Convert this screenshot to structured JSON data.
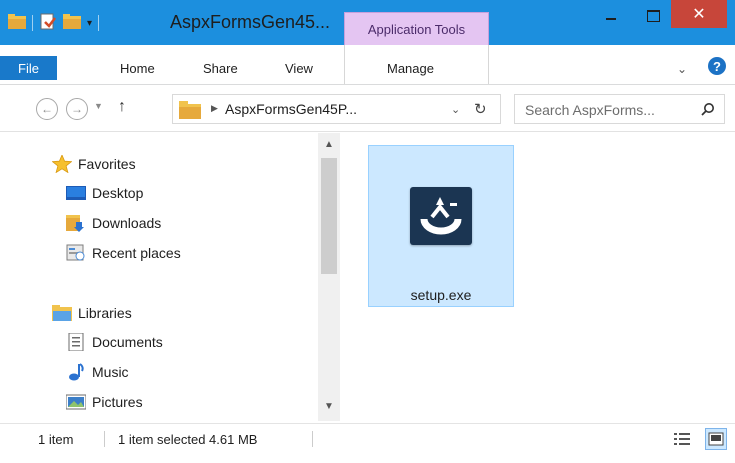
{
  "window": {
    "title": "AspxFormsGen45...",
    "context_tab": "Application Tools",
    "close_glyph": "✕"
  },
  "ribbon": {
    "tabs": [
      "File",
      "Home",
      "Share",
      "View",
      "Manage"
    ],
    "help_glyph": "?"
  },
  "address": {
    "path": "AspxFormsGen45P...",
    "search_placeholder": "Search AspxForms..."
  },
  "nav": {
    "favorites": {
      "label": "Favorites",
      "items": [
        "Desktop",
        "Downloads",
        "Recent places"
      ]
    },
    "libraries": {
      "label": "Libraries",
      "items": [
        "Documents",
        "Music",
        "Pictures"
      ]
    }
  },
  "content": {
    "files": [
      {
        "name": "setup.exe",
        "selected": true,
        "icon": "installer-icon"
      }
    ]
  },
  "status": {
    "item_count": "1 item",
    "selection": "1 item selected  4.61 MB"
  },
  "colors": {
    "titlebar": "#1c8fde",
    "file_tab": "#1979ca",
    "context_tab": "#e4c5f2",
    "close_button": "#c7463a",
    "selection": "#cce8ff"
  }
}
